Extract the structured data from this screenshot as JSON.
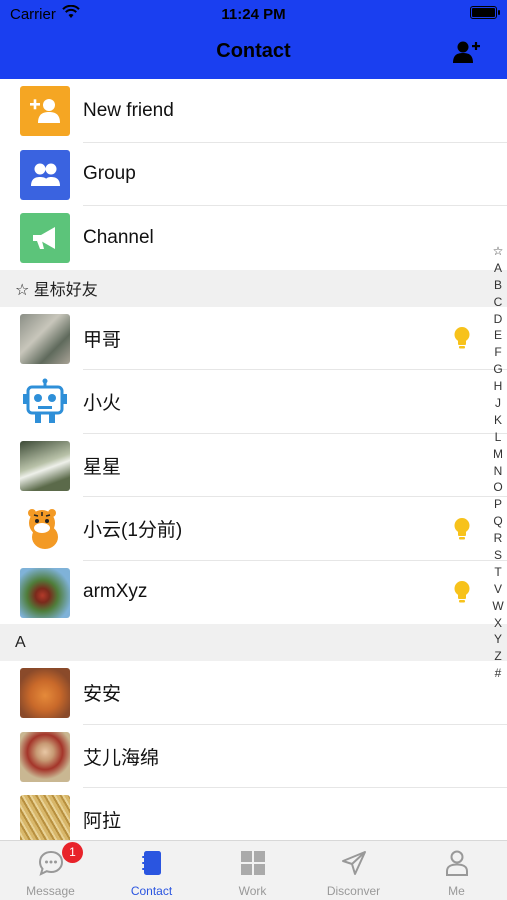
{
  "status": {
    "carrier": "Carrier",
    "time": "11:24 PM"
  },
  "header": {
    "title": "Contact"
  },
  "actions": [
    {
      "label": "New friend",
      "icon": "add-user-icon",
      "color": "#f5a623"
    },
    {
      "label": "Group",
      "icon": "group-icon",
      "color": "#3a63e0"
    },
    {
      "label": "Channel",
      "icon": "megaphone-icon",
      "color": "#5cc47a"
    }
  ],
  "starred": {
    "title": "☆ 星标好友",
    "contacts": [
      {
        "name": "甲哥",
        "avatar": "photo-avatar",
        "bulb": true
      },
      {
        "name": "小火",
        "avatar": "robot-avatar",
        "bulb": false
      },
      {
        "name": "星星",
        "avatar": "photo-avatar",
        "bulb": false
      },
      {
        "name": "小云(1分前)",
        "avatar": "tiger-avatar",
        "bulb": true
      },
      {
        "name": "armXyz",
        "avatar": "photo-avatar",
        "bulb": true
      }
    ]
  },
  "section_a": {
    "title": "A",
    "contacts": [
      {
        "name": "安安",
        "avatar": "cat-avatar"
      },
      {
        "name": "艾儿海绵",
        "avatar": "portrait-avatar"
      },
      {
        "name": "阿拉",
        "avatar": "noodles-avatar"
      }
    ]
  },
  "index_letters": [
    "☆",
    "A",
    "B",
    "C",
    "D",
    "E",
    "F",
    "G",
    "H",
    "J",
    "K",
    "L",
    "M",
    "N",
    "O",
    "P",
    "Q",
    "R",
    "S",
    "T",
    "V",
    "W",
    "X",
    "Y",
    "Z",
    "#"
  ],
  "tabs": [
    {
      "label": "Message",
      "icon": "chat-icon",
      "badge": "1"
    },
    {
      "label": "Contact",
      "icon": "contact-book-icon",
      "active": true
    },
    {
      "label": "Work",
      "icon": "grid-icon"
    },
    {
      "label": "Disconver",
      "icon": "send-icon"
    },
    {
      "label": "Me",
      "icon": "person-icon"
    }
  ],
  "colors": {
    "header": "#1a3ff0",
    "accent": "#2a55e0",
    "badge": "#e8232a",
    "bulb": "#f7c21b"
  }
}
